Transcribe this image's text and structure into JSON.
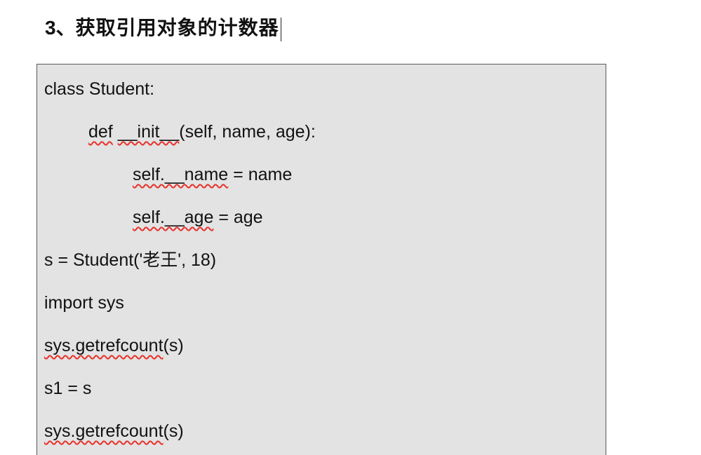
{
  "heading": {
    "number": "3、",
    "title": "获取引用对象的计数器"
  },
  "code": {
    "line1": "class Student:",
    "line2": {
      "kw": "def",
      "sp": " ",
      "init": "__init__",
      "args": "(self, name, age):"
    },
    "line3": {
      "lhs": "self.__name",
      "rhs": " = name"
    },
    "line4": {
      "lhs": "self.__age",
      "rhs": " = age"
    },
    "line5": {
      "pre": "s = Student('",
      "cjk": "老王",
      "post": "', 18)"
    },
    "line6": "import sys",
    "line7": {
      "fn": "sys.getrefcount",
      "args": "(s)"
    },
    "line8": "s1 = s",
    "line9": {
      "fn": "sys.getrefcount",
      "args": "(s)"
    }
  },
  "colors": {
    "code_background": "#e3e3e3",
    "spellcheck_underline": "#e8322b"
  }
}
